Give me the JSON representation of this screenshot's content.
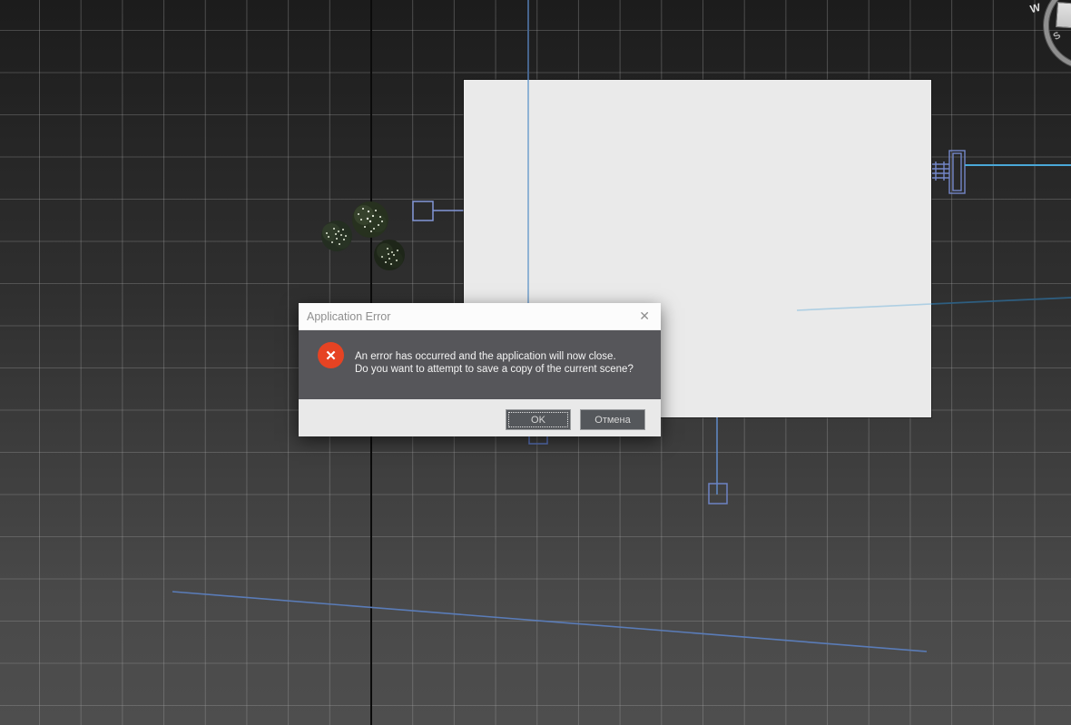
{
  "viewport": {
    "kind": "3d-top-viewport",
    "colors": {
      "background_top": "#1c1c1c",
      "background_bottom": "#4e4e4e",
      "grid_line": "#5f5f5f",
      "world_axis": "#0b0b0b",
      "plane_fill": "#eaeaea",
      "wireframe_blue": "#7487c9",
      "helper_blue": "#8296d8",
      "spline_blue": "#5a7cb8",
      "highlight_cyan": "#4aa8d8"
    }
  },
  "viewcube": {
    "west_label": "W",
    "south_label": "S"
  },
  "dialog": {
    "title": "Application Error",
    "close_glyph": "✕",
    "error_glyph": "✕",
    "message_line1": "An error has occurred and the application will now close.",
    "message_line2": "Do you want to attempt to save a copy of the current scene?",
    "buttons": {
      "ok": "OK",
      "cancel": "Отмена"
    }
  }
}
